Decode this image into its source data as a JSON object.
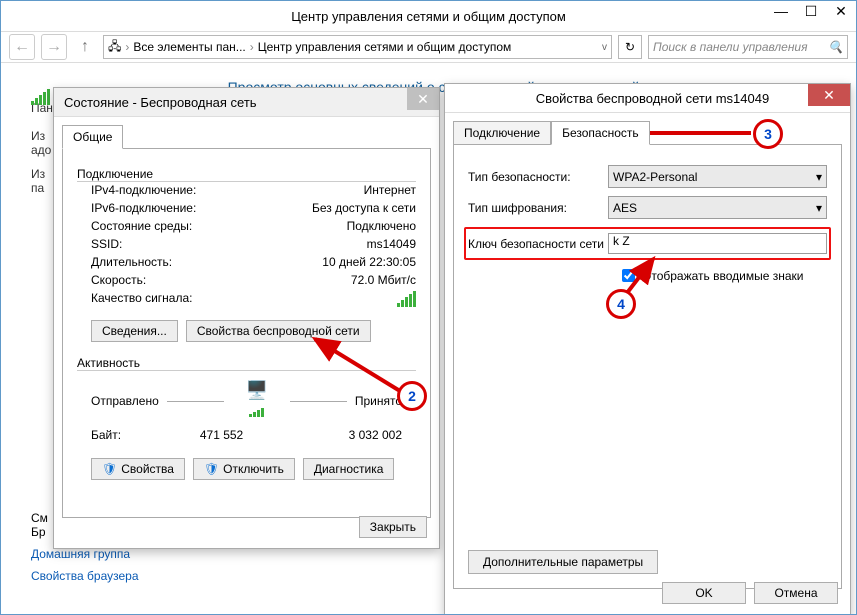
{
  "main": {
    "title": "Центр управления сетями и общим доступом",
    "breadcrumb": {
      "item1": "Все элементы пан...",
      "item2": "Центр управления сетями и общим доступом"
    },
    "search_placeholder": "Поиск в панели управления",
    "heading": "Просмотр основных сведений о сети и настройка подключений",
    "left": {
      "panel": "Пане",
      "iz": "Из",
      "ado": "адо",
      "iz2": "Из",
      "par": "па"
    },
    "trunc": {
      "sm": "См",
      "br": "Бр"
    },
    "links": {
      "home": "Домашняя группа",
      "browser": "Свойства браузера"
    }
  },
  "dlg1": {
    "title": "Состояние - Беспроводная сеть",
    "tab": "Общие",
    "section1": "Подключение",
    "ipv4_l": "IPv4-подключение:",
    "ipv4_v": "Интернет",
    "ipv6_l": "IPv6-подключение:",
    "ipv6_v": "Без доступа к сети",
    "state_l": "Состояние среды:",
    "state_v": "Подключено",
    "ssid_l": "SSID:",
    "ssid_v": "ms14049",
    "dur_l": "Длительность:",
    "dur_v": "10 дней 22:30:05",
    "speed_l": "Скорость:",
    "speed_v": "72.0 Мбит/с",
    "signal_l": "Качество сигнала:",
    "btn_details": "Сведения...",
    "btn_wprops": "Свойства беспроводной сети",
    "section2": "Активность",
    "sent": "Отправлено",
    "recv": "Принято",
    "bytes_l": "Байт:",
    "bytes_sent": "471 552",
    "bytes_recv": "3 032 002",
    "btn_props": "Свойства",
    "btn_disc": "Отключить",
    "btn_diag": "Диагностика",
    "btn_close": "Закрыть"
  },
  "dlg2": {
    "title": "Свойства беспроводной сети ms14049",
    "tab1": "Подключение",
    "tab2": "Безопасность",
    "sec_type_l": "Тип безопасности:",
    "sec_type_v": "WPA2-Personal",
    "enc_l": "Тип шифрования:",
    "enc_v": "AES",
    "key_l": "Ключ безопасности сети",
    "key_v": "k          Z",
    "show_chars": "Отображать вводимые знаки",
    "btn_adv": "Дополнительные параметры",
    "btn_ok": "OK",
    "btn_cancel": "Отмена"
  },
  "annot": {
    "n2": "2",
    "n3": "3",
    "n4": "4"
  }
}
